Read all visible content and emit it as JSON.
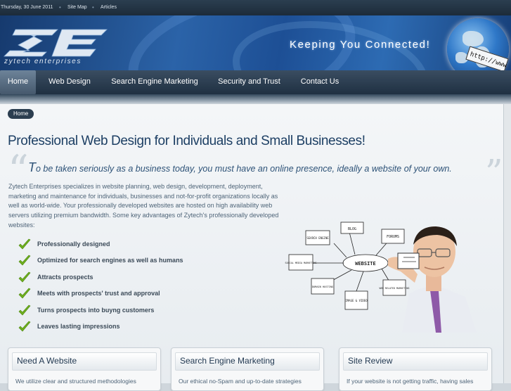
{
  "topbar": {
    "date": "Thursday, 30 June 2011",
    "links": [
      "Site Map",
      "Articles"
    ]
  },
  "banner": {
    "logo_sub": "zytech enterprises",
    "tagline": "Keeping You Connected!",
    "url_text": "http://www"
  },
  "nav": {
    "items": [
      "Home",
      "Web Design",
      "Search Engine Marketing",
      "Security and Trust",
      "Contact Us"
    ],
    "active": "Home"
  },
  "breadcrumb": "Home",
  "main": {
    "title": "Professional Web Design for Individuals and Small Businesses!",
    "quote_first": "T",
    "quote_rest": "o be taken seriously as a business today, you must have an online presence, ideally a website of your own.",
    "body": "Zytech Enterprises specializes in website planning, web design, development, deployment, marketing and maintenance for individuals, businesses and not-for-profit organizations locally as well as world-wide. Your professionally developed websites are hosted on high availability web servers utilizing premium bandwidth. Some key advantages of Zytech's professionally developed websites:",
    "advantages": [
      "Professionally designed",
      "Optimized for search engines as well as humans",
      "Attracts prospects",
      "Meets with prospects' trust and approval",
      "Turns prospects into buyng customers",
      "Leaves lasting impressions"
    ]
  },
  "illustration": {
    "center": "WEBSITE",
    "nodes": [
      "SEARCH ENGINE",
      "BLOG",
      "FORUMS",
      "SOCIAL MEDIA MARKETING",
      "DOMAIN HOSTING",
      "IMAGE & VIDEO",
      "WEB RELATED MARKETING"
    ]
  },
  "boxes": [
    {
      "title": "Need A Website",
      "text": "We utilize clear and structured methodologies"
    },
    {
      "title": "Search Engine Marketing",
      "text": "Our ethical no-Spam and up-to-date strategies"
    },
    {
      "title": "Site Review",
      "text": "If your website is not getting traffic, having sales"
    }
  ],
  "colors": {
    "accent": "#1d3f64",
    "check": "#6fae1f",
    "nav_bg": "#1f3042"
  }
}
